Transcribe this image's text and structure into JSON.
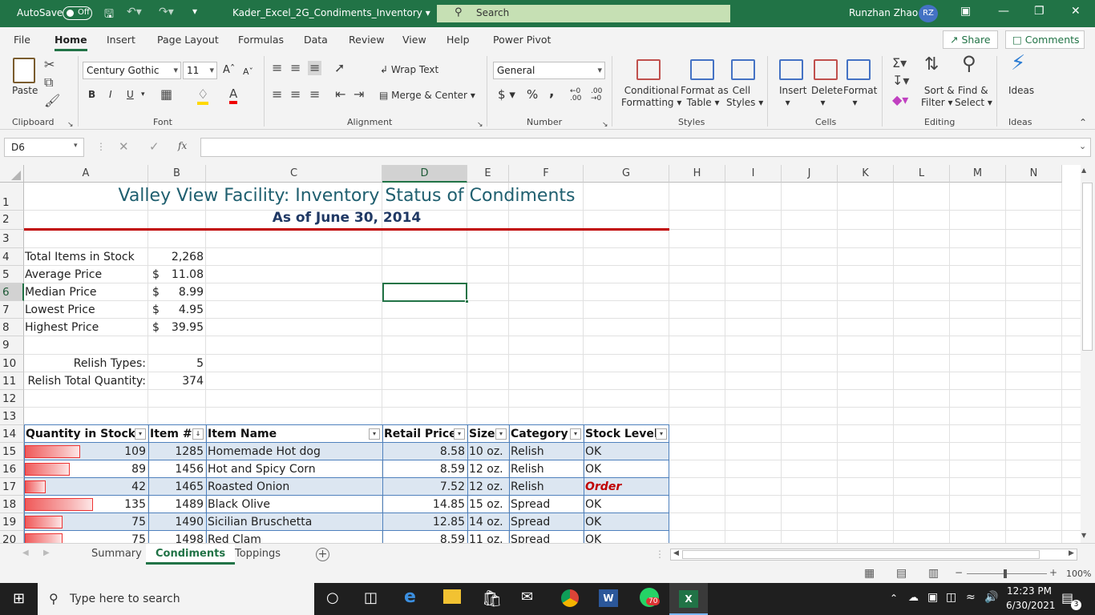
{
  "titlebar": {
    "autosave_label": "AutoSave",
    "autosave_state": "Off",
    "filename": "Kader_Excel_2G_Condiments_Inventory",
    "search_placeholder": "Search",
    "user_name": "Runzhan Zhao",
    "user_initials": "RZ"
  },
  "menu": {
    "tabs": [
      "File",
      "Home",
      "Insert",
      "Page Layout",
      "Formulas",
      "Data",
      "Review",
      "View",
      "Help",
      "Power Pivot"
    ],
    "active_tab": "Home",
    "share_label": "Share",
    "comments_label": "Comments"
  },
  "ribbon": {
    "clipboard": {
      "paste": "Paste",
      "group": "Clipboard"
    },
    "font": {
      "name": "Century Gothic",
      "size": "11",
      "bold": "B",
      "italic": "I",
      "underline": "U",
      "group": "Font"
    },
    "alignment": {
      "wrap": "Wrap Text",
      "merge": "Merge & Center",
      "group": "Alignment"
    },
    "number": {
      "format": "General",
      "currency": "$",
      "percent": "%",
      "comma": ",",
      "group": "Number"
    },
    "styles": {
      "conditional": [
        "Conditional",
        "Formatting"
      ],
      "format_table": [
        "Format as",
        "Table"
      ],
      "cell_styles": [
        "Cell",
        "Styles"
      ],
      "group": "Styles"
    },
    "cells": {
      "insert": "Insert",
      "delete": "Delete",
      "format": "Format",
      "group": "Cells"
    },
    "editing": {
      "sort": [
        "Sort &",
        "Filter"
      ],
      "find": [
        "Find &",
        "Select"
      ],
      "group": "Editing"
    },
    "ideas": {
      "label": "Ideas",
      "group": "Ideas"
    }
  },
  "formula_bar": {
    "name_box": "D6",
    "fx": "fx",
    "content": ""
  },
  "columns": [
    "A",
    "B",
    "C",
    "D",
    "E",
    "F",
    "G",
    "H",
    "I",
    "J",
    "K",
    "L",
    "M",
    "N"
  ],
  "selected_column": "D",
  "rows": [
    "1",
    "2",
    "3",
    "4",
    "5",
    "6",
    "7",
    "8",
    "9",
    "10",
    "11",
    "12",
    "13",
    "14",
    "15",
    "16",
    "17",
    "18",
    "19",
    "20"
  ],
  "selected_row": "6",
  "sheet": {
    "title": "Valley View Facility: Inventory Status of Condiments",
    "subtitle": "As of June 30, 2014",
    "stats": [
      {
        "label": "Total Items in Stock",
        "currency": "",
        "value": "2,268"
      },
      {
        "label": "Average Price",
        "currency": "$",
        "value": "11.08"
      },
      {
        "label": "Median Price",
        "currency": "$",
        "value": "8.99"
      },
      {
        "label": "Lowest Price",
        "currency": "$",
        "value": "4.95"
      },
      {
        "label": "Highest Price",
        "currency": "$",
        "value": "39.95"
      }
    ],
    "relish_types_label": "Relish Types:",
    "relish_types_value": "5",
    "relish_qty_label": "Relish Total Quantity:",
    "relish_qty_value": "374",
    "table_headers": [
      "Quantity in Stock",
      "Item #",
      "Item Name",
      "Retail Price",
      "Size",
      "Category",
      "Stock Level"
    ],
    "table_rows": [
      {
        "qty": "109",
        "item": "1285",
        "name": "Homemade Hot dog",
        "price": "8.58",
        "size": "10 oz.",
        "category": "Relish",
        "stock": "OK"
      },
      {
        "qty": "89",
        "item": "1456",
        "name": "Hot and Spicy Corn",
        "price": "8.59",
        "size": "12 oz.",
        "category": "Relish",
        "stock": "OK"
      },
      {
        "qty": "42",
        "item": "1465",
        "name": "Roasted Onion",
        "price": "7.52",
        "size": "12 oz.",
        "category": "Relish",
        "stock": "Order"
      },
      {
        "qty": "135",
        "item": "1489",
        "name": "Black Olive",
        "price": "14.85",
        "size": "15 oz.",
        "category": "Spread",
        "stock": "OK"
      },
      {
        "qty": "75",
        "item": "1490",
        "name": "Sicilian Bruschetta",
        "price": "12.85",
        "size": "14 oz.",
        "category": "Spread",
        "stock": "OK"
      },
      {
        "qty": "75",
        "item": "1498",
        "name": "Red Clam",
        "price": "8.59",
        "size": "11 oz.",
        "category": "Spread",
        "stock": "OK"
      }
    ]
  },
  "sheet_tabs": [
    "Summary",
    "Condiments",
    "Toppings"
  ],
  "active_sheet": "Condiments",
  "status": {
    "zoom": "100%"
  },
  "taskbar": {
    "search_placeholder": "Type here to search",
    "time": "12:23 PM",
    "date": "6/30/2021",
    "whatsapp_badge": "70",
    "notif_count": "3"
  },
  "colors": {
    "excel_green": "#217346",
    "title_teal": "#1f5f6f",
    "subtitle_navy": "#1f3864",
    "band": "#dce6f1",
    "order_red": "#c00000"
  }
}
